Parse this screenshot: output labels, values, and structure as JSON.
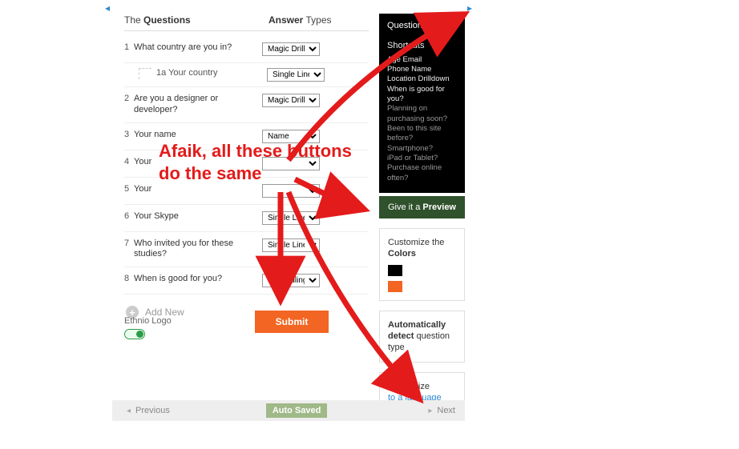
{
  "header": {
    "col_q_prefix": "The ",
    "col_q_bold": "Questions",
    "col_a_bold": "Answer",
    "col_a_suffix": " Types"
  },
  "questions": [
    {
      "n": "1",
      "text": "What country are you in?",
      "answer": "Magic Drill D"
    },
    {
      "n": "2",
      "text": "Are you a designer or developer?",
      "answer": "Magic Drill D"
    },
    {
      "n": "3",
      "text": "Your name",
      "answer": "Name"
    },
    {
      "n": "4",
      "text": "Your",
      "answer": ""
    },
    {
      "n": "5",
      "text": "Your",
      "answer": ""
    },
    {
      "n": "6",
      "text": "Your Skype",
      "answer": "Single Line"
    },
    {
      "n": "7",
      "text": "Who invited you for these studies?",
      "answer": "Single Line"
    },
    {
      "n": "8",
      "text": "When is good for you?",
      "answer": "Scheduling"
    }
  ],
  "sub_question": {
    "label": "1a Your country",
    "answer": "Single Line"
  },
  "add_new_label": "Add New",
  "logo": {
    "label": "Ethnio Logo"
  },
  "submit_label": "Submit",
  "preview": {
    "title": "Question",
    "subtitle": "Shortcuts",
    "items": [
      "Age Email",
      "Phone Name",
      "Location Drilldown",
      "When is good for you?",
      "Planning on purchasing soon?",
      "Been to this site before?",
      "Smartphone?",
      "iPad or Tablet?",
      "Purchase online often?"
    ],
    "button_prefix": "Give it a ",
    "button_bold": "Preview"
  },
  "colors_card": {
    "line1": "Customize the",
    "line2_bold": "Colors"
  },
  "detect_card": {
    "line1_bold": "Automatically detect",
    "line1_rest": " question type"
  },
  "language_card": {
    "line1": "Customize",
    "link": "to a language"
  },
  "footer": {
    "prev": "Previous",
    "autosave": "Auto Saved",
    "next": "Next"
  },
  "annotation": "Afaik, all these buttons do the same"
}
